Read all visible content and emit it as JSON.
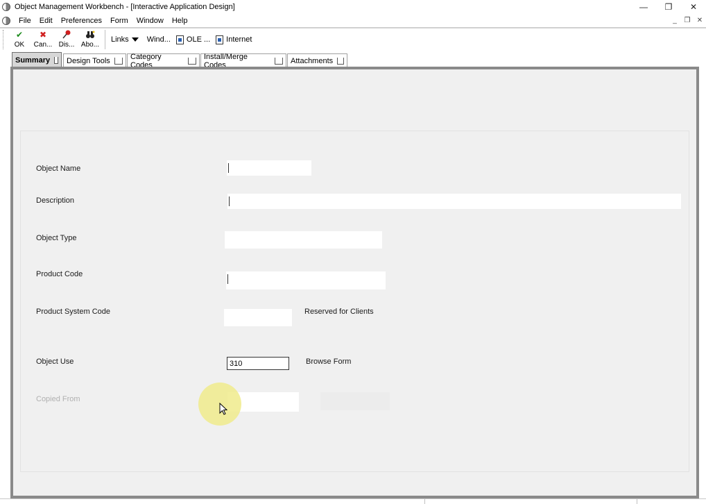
{
  "window": {
    "title": "Object Management Workbench - [Interactive Application Design]",
    "controls": {
      "minimize": "—",
      "restore": "❐",
      "close": "✕"
    },
    "mdi_controls": {
      "minimize": "_",
      "restore": "❐",
      "close": "✕"
    }
  },
  "menu": [
    "File",
    "Edit",
    "Preferences",
    "Form",
    "Window",
    "Help"
  ],
  "toolbar": {
    "ok_label": "OK",
    "cancel_label": "Can...",
    "display_label": "Dis...",
    "about_label": "Abo...",
    "links_label": "Links",
    "window_label": "Wind...",
    "ole_label": "OLE ...",
    "internet_label": "Internet"
  },
  "tabs": [
    "Summary",
    "Design Tools",
    "Category Codes",
    "Install/Merge Codes",
    "Attachments"
  ],
  "form": {
    "object_name_label": "Object Name",
    "object_name_value": "",
    "description_label": "Description",
    "description_value": "",
    "object_type_label": "Object Type",
    "object_type_value": "",
    "product_code_label": "Product Code",
    "product_code_value": "",
    "product_system_code_label": "Product System Code",
    "product_system_code_value": "",
    "product_system_code_desc": "Reserved for Clients",
    "object_use_label": "Object Use",
    "object_use_value": "310",
    "object_use_desc": "Browse Form",
    "copied_from_label": "Copied From",
    "copied_from_value": ""
  },
  "colors": {
    "panel_bg": "#f0f0f0",
    "panel_border": "#8a8a8a",
    "ok_green": "#1a8a1a",
    "cancel_red": "#d02020",
    "cursor_halo": "#f0eb8c"
  },
  "icons": {
    "ok": "checkmark-icon",
    "cancel": "x-icon",
    "display": "pushpin-icon",
    "about": "binoculars-icon"
  }
}
